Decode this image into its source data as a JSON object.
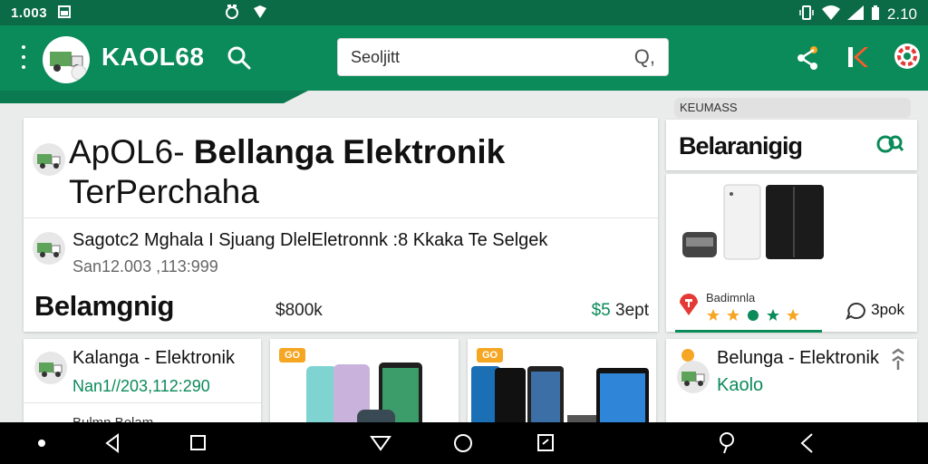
{
  "status_bar": {
    "time_left": "1.003",
    "time_right": "2.10",
    "icons_left": [
      "image-icon"
    ],
    "icons_center": [
      "alarm-icon",
      "location-icon"
    ],
    "icons_right": [
      "vibrate-icon",
      "wifi-icon",
      "signal-icon",
      "battery-icon"
    ]
  },
  "app_bar": {
    "title": "KAOL68",
    "search_placeholder": "Seoljitt",
    "search_icon_glyph": "Q,",
    "actions": [
      "share-icon",
      "k-logo-icon",
      "settings-icon"
    ]
  },
  "featured": {
    "title_prefix": "ApOL6- ",
    "title_bold": "Bellanga Elektronik",
    "title_line2": "TerPerchaha",
    "meta_line": "Sagotc2 Mghala I Sjuang DlelEletronnk :8 Kkaka Te Selgek",
    "date": "San12.003 ,113:999",
    "price_title": "Belamgnig",
    "price_mid": "$800k",
    "price_right_currency": "$5",
    "price_right_label": "3ept"
  },
  "sidebar": {
    "label": "KEUMASS",
    "title": "Belaranigig",
    "rating_label": "Badimnla",
    "count": "3pok"
  },
  "row_cards": [
    {
      "title": "Kalanga - Elektronik",
      "date": "Nan1//203,112:290",
      "footer": "Bulmn Belam"
    },
    {
      "badge": "GO"
    },
    {
      "badge": "GO"
    },
    {
      "title": "Belunga - Elektronik",
      "subtitle": "Kaolo"
    }
  ],
  "colors": {
    "primary": "#0b8a5a",
    "status_bar": "#0b6b46",
    "accent": "#f5a623",
    "nav_bar": "#000000"
  },
  "nav_bar": {
    "buttons": [
      "dot-icon",
      "back-icon",
      "recents-icon",
      "triangle-down-icon",
      "home-icon",
      "screenshot-icon",
      "search-icon",
      "back-alt-icon"
    ]
  }
}
